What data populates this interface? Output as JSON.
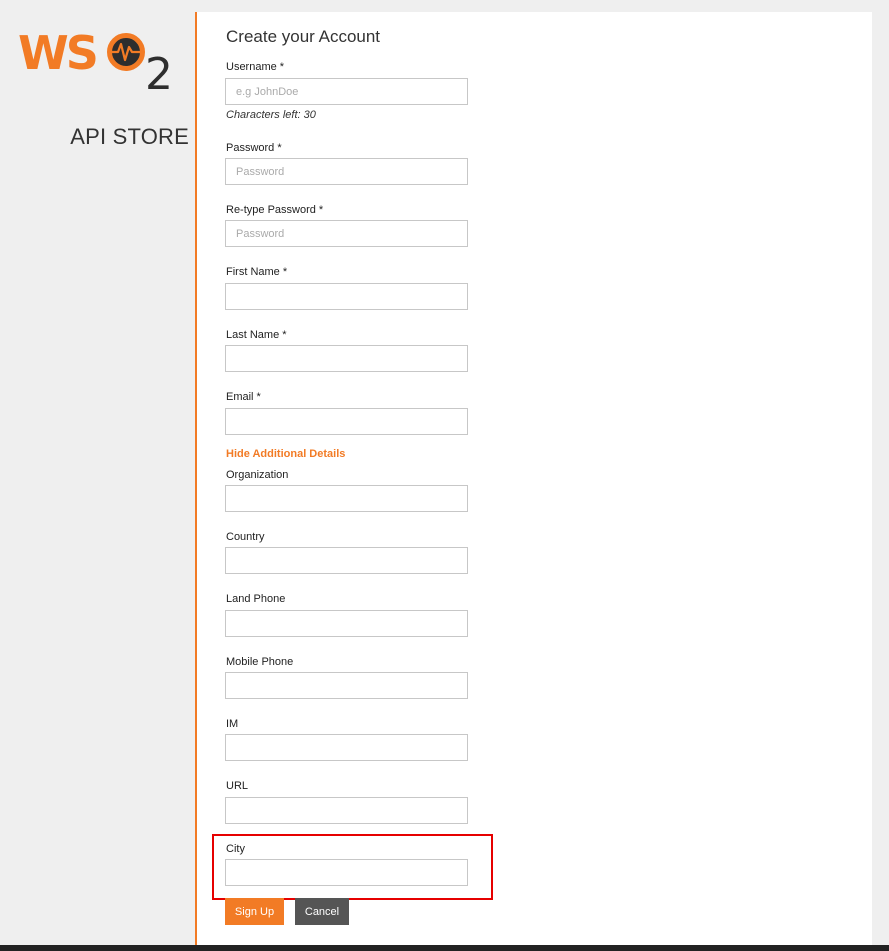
{
  "brand": {
    "logo_text": "WSO2",
    "product": "API STORE",
    "colors": {
      "accent": "#f27b25",
      "dark": "#2e2e2e",
      "highlight": "#e60000",
      "cancel": "#555555"
    }
  },
  "form": {
    "title": "Create your Account",
    "username": {
      "label": "Username *",
      "placeholder": "e.g JohnDoe",
      "value": "",
      "hint": "Characters left: 30"
    },
    "password": {
      "label": "Password *",
      "placeholder": "Password",
      "value": ""
    },
    "retype_password": {
      "label": "Re-type Password *",
      "placeholder": "Password",
      "value": ""
    },
    "first_name": {
      "label": "First Name *",
      "value": ""
    },
    "last_name": {
      "label": "Last Name *",
      "value": ""
    },
    "email": {
      "label": "Email *",
      "value": ""
    },
    "toggle_details": "Hide Additional Details",
    "organization": {
      "label": "Organization",
      "value": ""
    },
    "country": {
      "label": "Country",
      "value": ""
    },
    "land_phone": {
      "label": "Land Phone",
      "value": ""
    },
    "mobile_phone": {
      "label": "Mobile Phone",
      "value": ""
    },
    "im": {
      "label": "IM",
      "value": ""
    },
    "url": {
      "label": "URL",
      "value": ""
    },
    "city": {
      "label": "City",
      "value": ""
    },
    "signup_label": "Sign Up",
    "cancel_label": "Cancel"
  },
  "icons": {
    "logo_o": "heartbeat-icon"
  }
}
